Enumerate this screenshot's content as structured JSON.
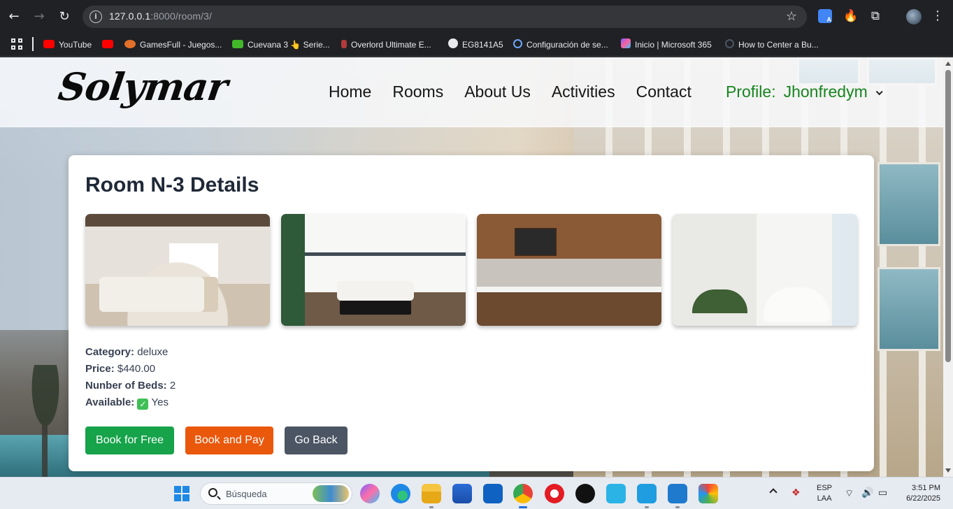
{
  "browser": {
    "url_host": "127.0.0.1",
    "url_rest": ":8000/room/3/",
    "bookmarks": [
      {
        "label": "YouTube",
        "icon": "youtube-icon"
      },
      {
        "label": "",
        "icon": "youtube-icon"
      },
      {
        "label": "GamesFull - Juegos...",
        "icon": "gamepad-icon"
      },
      {
        "label": "Cuevana 3 👆 Serie...",
        "icon": "cuevana-icon"
      },
      {
        "label": "Overlord Ultimate E...",
        "icon": "overlord-icon"
      },
      {
        "label": "EG8141A5",
        "icon": "globe-icon"
      },
      {
        "label": "Configuración de se...",
        "icon": "ring-icon"
      },
      {
        "label": "Inicio | Microsoft 365",
        "icon": "microsoft365-icon"
      },
      {
        "label": "How to Center a Bu...",
        "icon": "circle-icon"
      }
    ]
  },
  "site": {
    "logo": "Solymar",
    "nav": [
      "Home",
      "Rooms",
      "About Us",
      "Activities",
      "Contact"
    ],
    "profile_label": "Profile:",
    "profile_name": "Jhonfredym"
  },
  "room": {
    "title": "Room N-3 Details",
    "photos": [
      "bedroom-photo",
      "living-room-photo",
      "kitchenette-photo",
      "bathroom-photo"
    ],
    "category_label": "Category:",
    "category": "deluxe",
    "price_label": "Price:",
    "price": "$440.00",
    "beds_label": "Nunber of Beds:",
    "beds": "2",
    "available_label": "Available:",
    "available_icon": "✓",
    "available": "Yes"
  },
  "actions": {
    "book_free": "Book for Free",
    "book_pay": "Book and Pay",
    "go_back": "Go Back"
  },
  "colors": {
    "book_free": "#16a34a",
    "book_pay": "#ea580c",
    "go_back": "#4b5563",
    "profile": "#16851e"
  },
  "taskbar": {
    "search_placeholder": "Búsqueda",
    "lang_top": "ESP",
    "lang_bottom": "LAA",
    "time": "3:51 PM",
    "date": "6/22/2025"
  }
}
